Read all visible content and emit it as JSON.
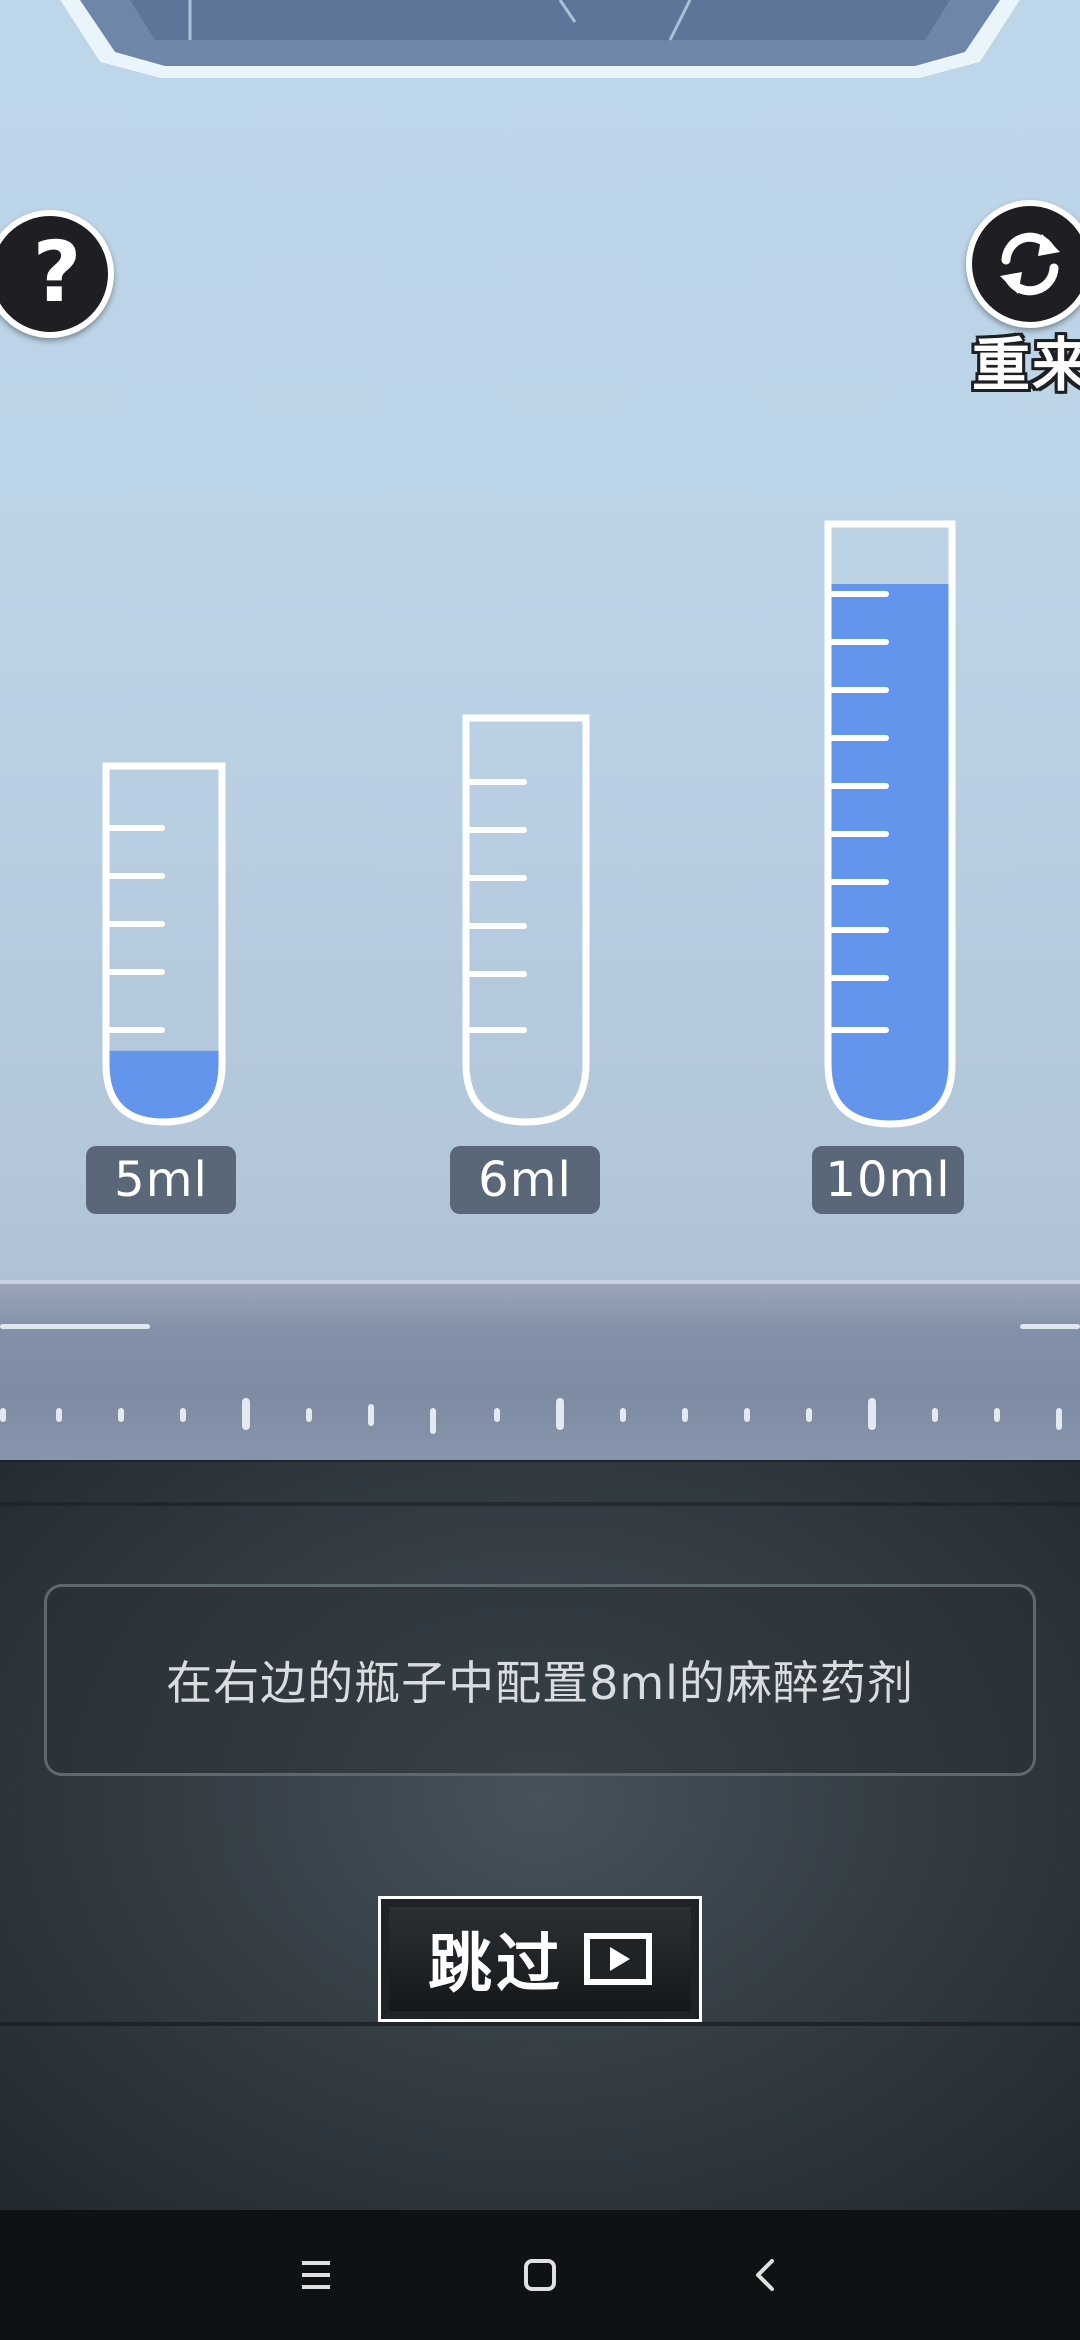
{
  "top_bar": {
    "help_symbol": "?",
    "restart_label": "重来"
  },
  "icons": {
    "help": "question-mark-icon",
    "restart": "refresh-icon",
    "skip": "play-icon",
    "nav_menu": "menu-icon",
    "nav_home": "home-square-icon",
    "nav_back": "back-chevron-icon"
  },
  "tubes": [
    {
      "label": "5ml",
      "fill_fraction": 0.2
    },
    {
      "label": "6ml",
      "fill_fraction": 0.0
    },
    {
      "label": "10ml",
      "fill_fraction": 0.9
    }
  ],
  "instruction": {
    "text": "在右边的瓶子中配置8ml的麻醉药剂"
  },
  "skip_button": {
    "label": "跳过"
  },
  "colors": {
    "liquid": "#6495ec",
    "tube_outline": "#ffffff",
    "label_bg": "#5a6778"
  }
}
